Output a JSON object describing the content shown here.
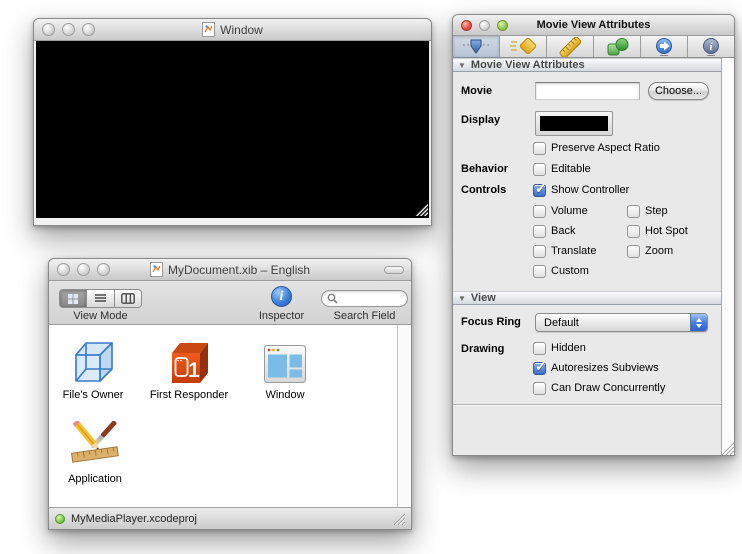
{
  "movie_window": {
    "title": "Window"
  },
  "doc_window": {
    "title": "MyDocument.xib – English",
    "toolbar": {
      "view_mode_label": "View Mode",
      "inspector_label": "Inspector",
      "inspector_glyph": "i",
      "search_field_label": "Search Field",
      "search_value": ""
    },
    "items": [
      {
        "label": "File's Owner",
        "icon": "files-owner-cube-icon"
      },
      {
        "label": "First Responder",
        "icon": "first-responder-cube-icon"
      },
      {
        "label": "Window",
        "icon": "window-icon"
      },
      {
        "label": "Application",
        "icon": "application-icon"
      }
    ],
    "status_text": "MyMediaPlayer.xcodeproj"
  },
  "inspector": {
    "title": "Movie View Attributes",
    "tabs": [
      {
        "name": "attributes-icon",
        "selected": true
      },
      {
        "name": "effects-icon",
        "selected": false
      },
      {
        "name": "size-icon",
        "selected": false
      },
      {
        "name": "bindings-icon",
        "selected": false
      },
      {
        "name": "connections-icon",
        "selected": false
      },
      {
        "name": "identity-icon",
        "selected": false
      }
    ],
    "attributes_section": {
      "header": "Movie View Attributes",
      "movie_label": "Movie",
      "movie_value": "",
      "choose_button": "Choose...",
      "display_label": "Display",
      "display_color": "#000000",
      "rows": [
        {
          "label": "",
          "checks": [
            {
              "label": "Preserve Aspect Ratio",
              "checked": false
            }
          ]
        },
        {
          "label": "Behavior",
          "checks": [
            {
              "label": "Editable",
              "checked": false
            }
          ]
        },
        {
          "label": "Controls",
          "checks": [
            {
              "label": "Show Controller",
              "checked": true
            }
          ]
        },
        {
          "label": "",
          "checks": [
            {
              "label": "Volume",
              "checked": false
            },
            {
              "label": "Step",
              "checked": false
            }
          ]
        },
        {
          "label": "",
          "checks": [
            {
              "label": "Back",
              "checked": false
            },
            {
              "label": "Hot Spot",
              "checked": false
            }
          ]
        },
        {
          "label": "",
          "checks": [
            {
              "label": "Translate",
              "checked": false
            },
            {
              "label": "Zoom",
              "checked": false
            }
          ]
        },
        {
          "label": "",
          "checks": [
            {
              "label": "Custom",
              "checked": false
            }
          ]
        }
      ]
    },
    "view_section": {
      "header": "View",
      "focus_ring_label": "Focus Ring",
      "focus_ring_value": "Default",
      "drawing_label": "Drawing",
      "checks": [
        {
          "label": "Hidden",
          "checked": false
        },
        {
          "label": "Autoresizes Subviews",
          "checked": true
        },
        {
          "label": "Can Draw Concurrently",
          "checked": false
        }
      ]
    }
  },
  "colors": {
    "check_blue": "#3e6fc9",
    "status_green": "#53a32a",
    "traffic_red": "#e85248",
    "traffic_green": "#96cc4c",
    "selected_tab_blue": "#b7c3d6"
  }
}
